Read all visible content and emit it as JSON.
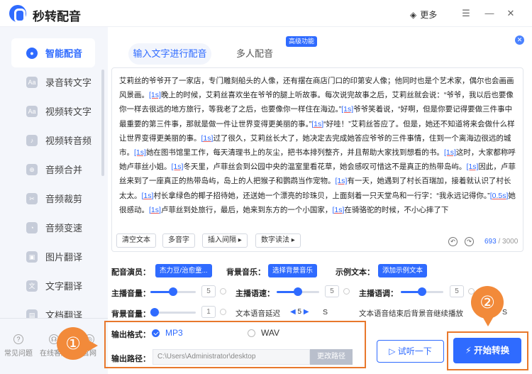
{
  "app": {
    "title": "秒转配音",
    "more_label": "更多"
  },
  "sidebar": {
    "items": [
      {
        "label": "智能配音",
        "icon": "mic-icon"
      },
      {
        "label": "录音转文字",
        "icon": "audio-text-icon"
      },
      {
        "label": "视频转文字",
        "icon": "video-text-icon"
      },
      {
        "label": "视频转音频",
        "icon": "video-audio-icon"
      },
      {
        "label": "音频合并",
        "icon": "merge-icon"
      },
      {
        "label": "音频裁剪",
        "icon": "cut-icon"
      },
      {
        "label": "音频变速",
        "icon": "speed-icon"
      },
      {
        "label": "图片翻译",
        "icon": "image-translate-icon"
      },
      {
        "label": "文字翻译",
        "icon": "text-translate-icon"
      },
      {
        "label": "文档翻译",
        "icon": "doc-translate-icon"
      }
    ],
    "bottom": [
      {
        "label": "常见问题"
      },
      {
        "label": "在线客服"
      },
      {
        "label": "官网"
      }
    ]
  },
  "tabs": {
    "tab1": "输入文字进行配音",
    "tab2": "多人配音",
    "badge": "高级功能"
  },
  "editor": {
    "segments": [
      {
        "t": "艾莉丝的爷爷开了一家店，专门雕刻船头的人像，还有摆在商店门口的印第安人像；他同时也是个艺术家，偶尔也会画画风景画。"
      },
      {
        "tag": "[1s]"
      },
      {
        "t": "晚上的时候，艾莉丝喜欢坐在爷爷的腿上听故事。每次说完故事之后，艾莉丝就会说：“爷爷，我以后也要像你一样去很远的地方旅行，等我老了之后，也要像你一样住在海边。”"
      },
      {
        "tag": "[1s]"
      },
      {
        "t": "爷爷笑着说，“好啊，但是你要记得要做三件事中最重要的第三件事，那就是做一件让世界变得更美丽的事。”"
      },
      {
        "tag": "[1s]"
      },
      {
        "t": "“好哇！”艾莉丝答应了。但是，她还不知道将来会做什么样让世界变得更美丽的事。"
      },
      {
        "tag": "[1s]"
      },
      {
        "t": "过了很久，艾莉丝长大了，她决定去完成她答应爷爷的三件事情，住到一个离海边很远的城市。"
      },
      {
        "tag": "[1s]"
      },
      {
        "t": "她在图书馆里工作，每天清理书上的灰尘，把书本排列整齐，并且帮助大家找到想看的书。"
      },
      {
        "tag": "[1s]"
      },
      {
        "t": "这时，大家都称呼她卢菲丝小姐。"
      },
      {
        "tag": "[1s]"
      },
      {
        "t": "冬天里，卢菲丝会到公园中央的温室里看花草，她会感叹可惜这不是真正的热带岛屿。"
      },
      {
        "tag": "[1s]"
      },
      {
        "t": "因此，卢菲丝来到了一座真正的热带岛屿，岛上的人把猴子和鹦鹉当作宠物。"
      },
      {
        "tag": "[1s]"
      },
      {
        "t": "有一天，她遇到了村长百瑞加，接着就认识了村长太太。"
      },
      {
        "tag": "[1s]"
      },
      {
        "t": "村长拿绿色的椰子招待她，还送她一个漂亮的珍珠贝，上面刻着一只天堂鸟和一行字：“我永远记得你。”"
      },
      {
        "tag": "[0.5s]"
      },
      {
        "t": "她很感动。"
      },
      {
        "tag": "[1s]"
      },
      {
        "t": "卢菲丝到处旅行，最后，她来到东方的一个小国家，"
      },
      {
        "tag": "[1s]"
      },
      {
        "t": "在骑骆驼的时候，不小心摔了下"
      }
    ],
    "buttons": [
      "清空文本",
      "多音字",
      "插入间隔 ▸",
      "数字读法 ▸"
    ],
    "count": "693",
    "max": "/ 3000"
  },
  "settings": {
    "anchor_label": "配音演员：",
    "anchor_value": "杰力豆/治愈童...",
    "bgm_label": "背景音乐：",
    "bgm_value": "选择背景音乐",
    "sample_label": "示例文本：",
    "sample_value": "添加示例文本",
    "vol_label": "主播音量：",
    "vol_value": "5",
    "vol_level": 0.5,
    "speed_label": "主播语速：",
    "speed_value": "5",
    "speed_level": 0.5,
    "pitch_label": "主播语调：",
    "pitch_value": "5",
    "pitch_level": 0.5,
    "bgvol_label": "背景音量：",
    "bgvol_value": "1",
    "bgvol_level": 0.1,
    "delay_label": "文本语音延迟",
    "delay_value": "5",
    "delay_unit": "S",
    "continue_label": "文本语音结束后背景音继续播放",
    "continue_unit": "S"
  },
  "output": {
    "format_label": "输出格式：",
    "opt_mp3": "MP3",
    "opt_wav": "WAV",
    "selected": "MP3",
    "path_label": "输出路径：",
    "path_value": "C:\\Users\\Administrator\\desktop",
    "change_path": "更改路径"
  },
  "actions": {
    "listen": "试听一下",
    "start": "开始转换"
  },
  "markers": {
    "one": "①",
    "two": "②"
  },
  "colors": {
    "accent": "#2f6bff",
    "highlight": "#e8782c",
    "marker": "#f28a3a"
  }
}
